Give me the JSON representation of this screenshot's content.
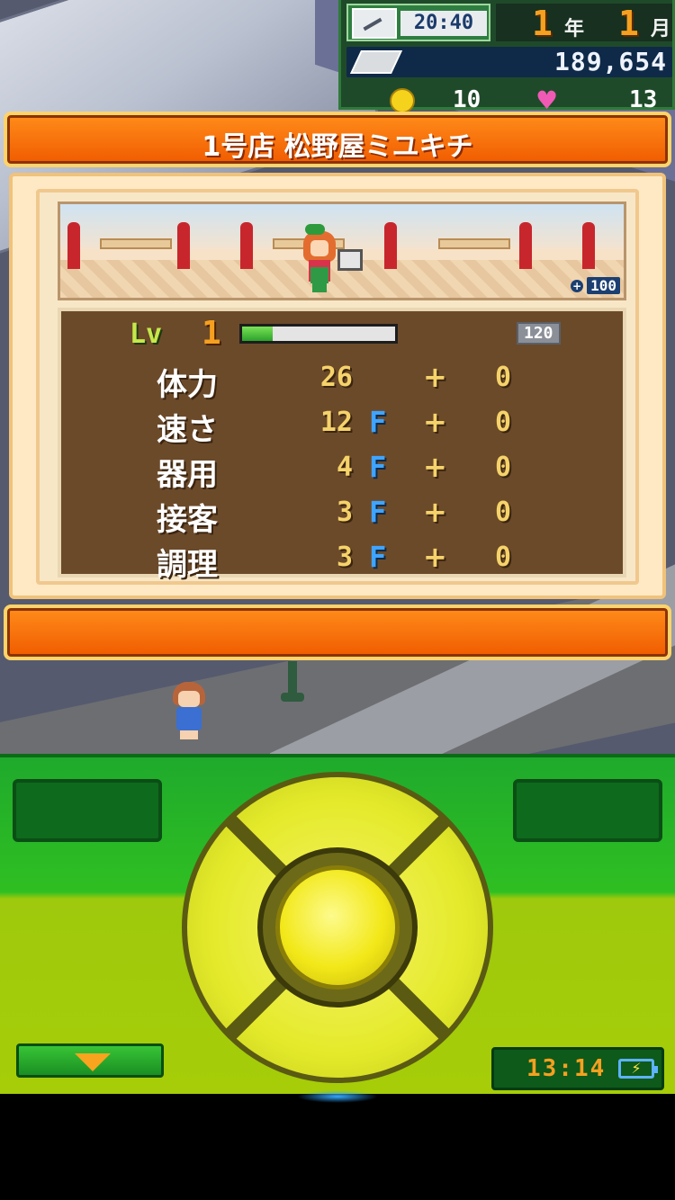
{
  "hud": {
    "time": "20:40",
    "year_value": "1",
    "year_unit": "年",
    "month_value": "1",
    "month_unit": "月",
    "money": "189,654",
    "coins": "10",
    "hearts": "13"
  },
  "dialog": {
    "title": "1号店 松野屋ミユキチ",
    "scene_bonus_value": "100",
    "level_label": "Lv",
    "level_value": "1",
    "exp_progress": 0.2,
    "exp_max": "120",
    "stats": [
      {
        "name": "体力",
        "value": "26",
        "rank": "",
        "plus": "+",
        "bonus": "0"
      },
      {
        "name": "速さ",
        "value": "12",
        "rank": "F",
        "plus": "+",
        "bonus": "0"
      },
      {
        "name": "器用",
        "value": "4",
        "rank": "F",
        "plus": "+",
        "bonus": "0"
      },
      {
        "name": "接客",
        "value": "3",
        "rank": "F",
        "plus": "+",
        "bonus": "0"
      },
      {
        "name": "調理",
        "value": "3",
        "rank": "F",
        "plus": "+",
        "bonus": "0"
      }
    ]
  },
  "controller": {
    "clock": "13:14",
    "battery_icon": "charging-battery-icon",
    "menu_icon": "down-triangle-icon"
  },
  "colors": {
    "title_orange": "#f05b00",
    "stat_panel": "#6b4a2a",
    "controller_green": "#1faa2c"
  }
}
